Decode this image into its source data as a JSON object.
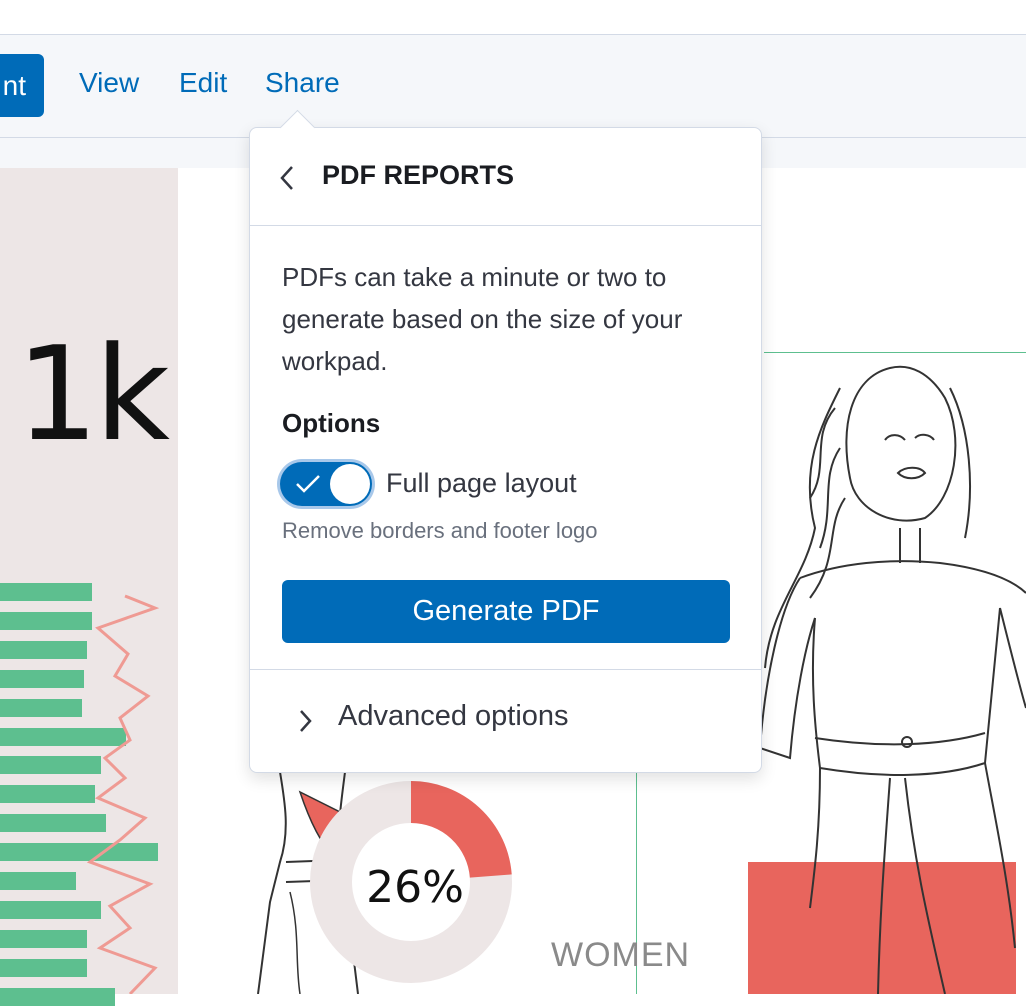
{
  "toolbar": {
    "primary_button_label": "nt",
    "nav": [
      "View",
      "Edit",
      "Share"
    ]
  },
  "workpad": {
    "metric": "1k",
    "donut_percent": "26%",
    "women_label": "WOMEN",
    "donut_value": 0.26,
    "bars": [
      0.58,
      0.58,
      0.55,
      0.53,
      0.52,
      0.8,
      0.64,
      0.6,
      0.67,
      1.0,
      0.48,
      0.64,
      0.55,
      0.55,
      0.73
    ]
  },
  "popover": {
    "title": "PDF REPORTS",
    "description": "PDFs can take a minute or two to generate based on the size of your workpad.",
    "options_title": "Options",
    "toggle": {
      "label": "Full page layout",
      "checked": true
    },
    "help_text": "Remove borders and footer logo",
    "generate_button": "Generate PDF",
    "advanced": "Advanced options"
  },
  "colors": {
    "accent": "#006bb8",
    "bars": "#5dbf8f",
    "line": "#ef9a93",
    "highlight": "#e8655d",
    "panel": "#ede6e6"
  }
}
